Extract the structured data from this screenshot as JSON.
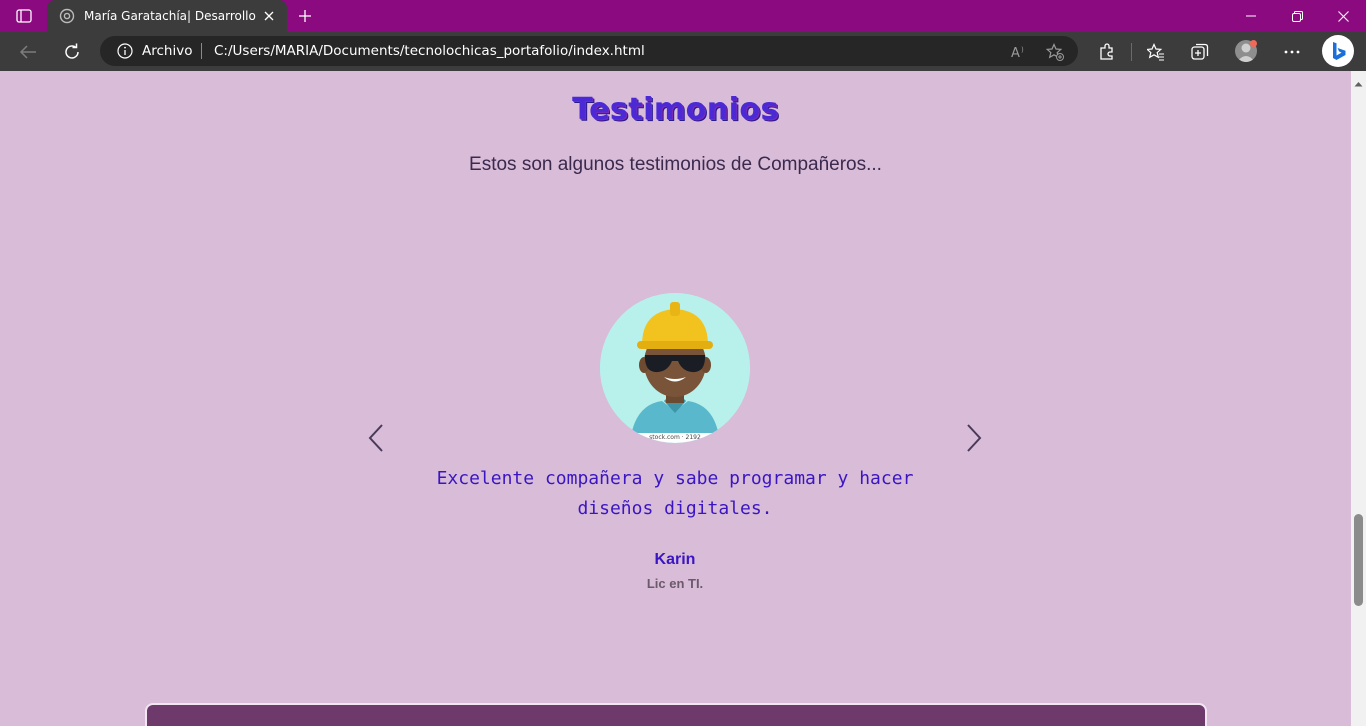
{
  "browser": {
    "tab_title": "María Garatachía| Desarrollo Web",
    "site_info_label": "Archivo",
    "url": "C:/Users/MARIA/Documents/tecnolochicas_portafolio/index.html",
    "colors": {
      "tabbar": "#8b0a7f",
      "toolbar": "#3c3c3c"
    },
    "icons": [
      "tab-actions-icon",
      "tab-favicon",
      "close-icon",
      "plus-icon",
      "minimize-icon",
      "restore-icon",
      "close-window-icon",
      "back-icon",
      "refresh-icon",
      "info-icon",
      "read-aloud-icon",
      "add-favorite-icon",
      "extensions-icon",
      "favorites-icon",
      "collections-icon",
      "profile-icon",
      "more-icon",
      "bing-icon"
    ]
  },
  "page": {
    "section_title": "Testimonios",
    "section_subtitle": "Estos son algunos testimonios de Compañeros...",
    "testimonial": {
      "image_watermark": "...stock.com · 2192...",
      "quote": "Excelente compañera y sabe programar y hacer diseños digitales.",
      "name": "Karin",
      "role": "Lic en TI."
    },
    "colors": {
      "background": "#d8bcd8",
      "accent": "#3a16c2",
      "footer": "#6d3a6b"
    }
  }
}
